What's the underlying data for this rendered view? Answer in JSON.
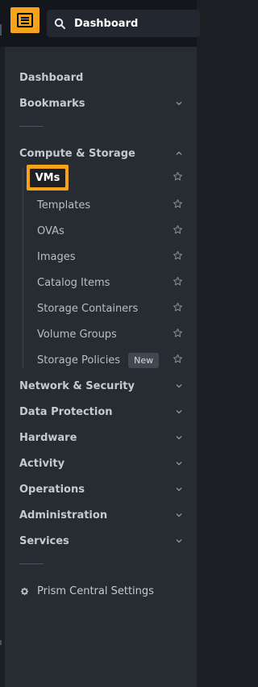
{
  "header": {
    "search_value": "Dashboard"
  },
  "nav": {
    "dashboard": "Dashboard",
    "bookmarks": "Bookmarks",
    "compute_storage": {
      "label": "Compute & Storage",
      "items": [
        "VMs",
        "Templates",
        "OVAs",
        "Images",
        "Catalog Items",
        "Storage Containers",
        "Volume Groups",
        "Storage Policies"
      ],
      "storage_policies_badge": "New"
    },
    "sections": [
      "Network & Security",
      "Data Protection",
      "Hardware",
      "Activity",
      "Operations",
      "Administration",
      "Services"
    ],
    "settings": "Prism Central Settings"
  },
  "colors": {
    "accent": "#f7a21b",
    "panel_bg": "#272c33",
    "topbar_bg": "#13161a"
  },
  "icons": [
    "hamburger-menu-icon",
    "search-icon",
    "chevron-down-icon",
    "chevron-up-icon",
    "star-icon",
    "gear-icon"
  ]
}
